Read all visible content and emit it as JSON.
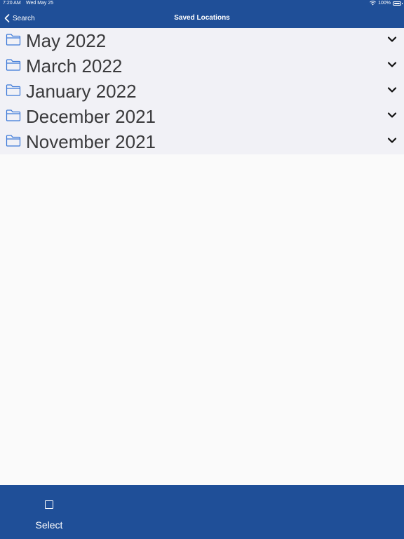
{
  "status_bar": {
    "time": "7:20 AM",
    "date": "Wed May 25",
    "battery": "100%"
  },
  "nav": {
    "back_label": "Search",
    "title": "Saved Locations"
  },
  "folders": [
    {
      "label": "May 2022"
    },
    {
      "label": "March 2022"
    },
    {
      "label": "January 2022"
    },
    {
      "label": "December 2021"
    },
    {
      "label": "November 2021"
    }
  ],
  "toolbar": {
    "select_label": "Select"
  },
  "colors": {
    "bar_background": "#1f4f98",
    "list_background": "#f1f1f6",
    "folder_icon": "#3b78d8"
  }
}
